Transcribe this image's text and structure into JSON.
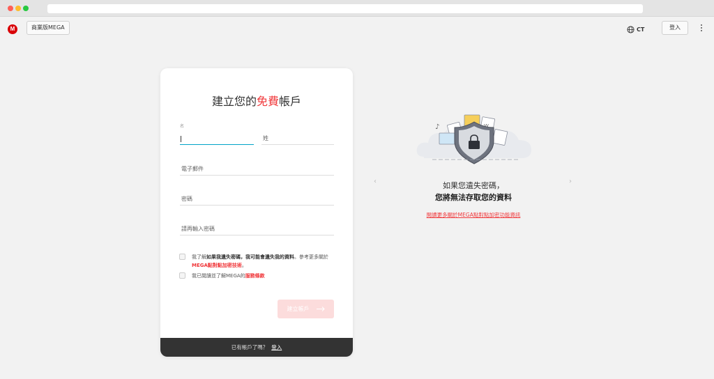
{
  "header": {
    "logo_letter": "M",
    "business_button": "商業版MEGA",
    "language": "CT",
    "login_button": "登入"
  },
  "form": {
    "title_part1": "建立您的",
    "title_highlight": "免費",
    "title_part2": "帳戶",
    "first_name_label": "名",
    "first_name_value": "",
    "last_name_placeholder": "姓",
    "email_placeholder": "電子郵件",
    "password_placeholder": "密碼",
    "confirm_password_placeholder": "請再輸入密碼",
    "terms1_prefix": "我了解",
    "terms1_bold": "如果我遺失密碼，我可能會遺失我的資料",
    "terms1_mid": "。參考更多關於",
    "terms1_link": "MEGA點對點加密技術",
    "terms1_suffix": "。",
    "terms2_prefix": "我已閱讀並了解MEGA的",
    "terms2_link": "服務條款",
    "create_button": "建立帳戶",
    "footer_text": "已有帳戶了嗎？",
    "footer_link": "登入"
  },
  "info": {
    "line1": "如果您遺失密碼，",
    "line2": "您將無法存取您的資料",
    "link": "閱讀更多關於MEGA點對點加密功能資訊"
  },
  "colors": {
    "brand_red": "#d90007",
    "accent_red": "#f0373a",
    "button_disabled": "#fcdcdc",
    "footer_bg": "#333333",
    "focus_underline": "#00a3c7"
  },
  "icons": {
    "globe": "globe-icon",
    "kebab": "more-vertical-icon",
    "arrow": "arrow-right-icon",
    "prev": "chevron-left-icon",
    "next": "chevron-right-icon"
  }
}
